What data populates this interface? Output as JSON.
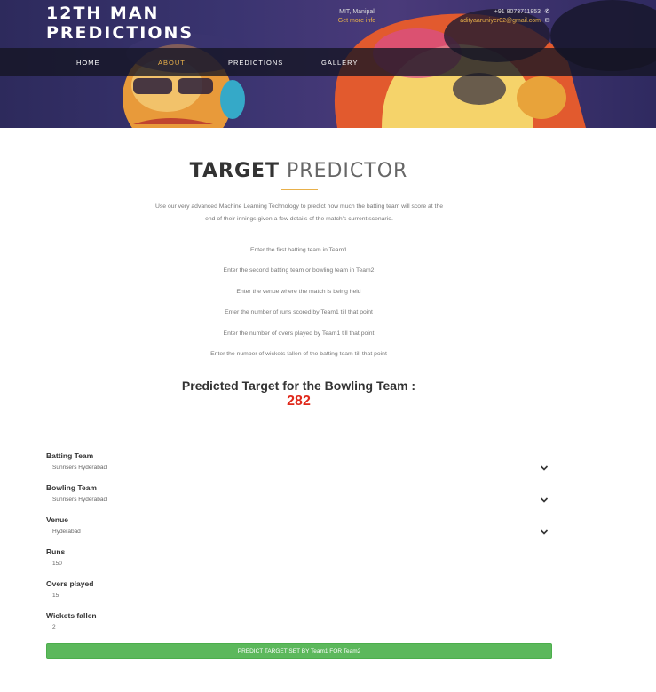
{
  "header": {
    "brand_line1": "12TH MAN",
    "brand_line2": "PREDICTIONS",
    "location": "MIT, Manipal",
    "more_info": "Get more info",
    "phone": "+91 8073711853",
    "email": "adityaaruniyer02@gmail.com"
  },
  "nav": {
    "items": [
      "HOME",
      "ABOUT",
      "PREDICTIONS",
      "GALLERY"
    ],
    "active": "ABOUT"
  },
  "main": {
    "title_bold": "TARGET",
    "title_light": "PREDICTOR",
    "intro": "Use our very advanced Machine Learning Technology to predict how much the batting team will score at the end of their innings given a few details of the match's current scenario.",
    "steps": [
      "Enter the first batting team in Team1",
      "Enter the second batting team or bowling team in Team2",
      "Enter the venue where the match is being held",
      "Enter the number of runs scored by Team1 till that point",
      "Enter the number of overs played by Team1 till that point",
      "Enter the number of wickets fallen of the batting team till that point"
    ],
    "prediction_label": "Predicted Target for the Bowling Team :",
    "prediction_value": "282"
  },
  "form": {
    "batting_team": {
      "label": "Batting Team",
      "value": "Sunrisers Hyderabad"
    },
    "bowling_team": {
      "label": "Bowling Team",
      "value": "Sunrisers Hyderabad"
    },
    "venue": {
      "label": "Venue",
      "value": "Hyderabad"
    },
    "runs": {
      "label": "Runs",
      "value": "150"
    },
    "overs": {
      "label": "Overs played",
      "value": "15"
    },
    "wickets": {
      "label": "Wickets fallen",
      "value": "2"
    },
    "submit_label": "PREDICT TARGET SET BY Team1 FOR Team2"
  },
  "colors": {
    "accent": "#e8b04a",
    "prediction": "#e0281a",
    "button": "#5cb85c"
  }
}
